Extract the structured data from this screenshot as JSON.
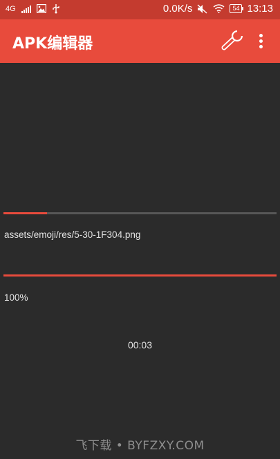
{
  "status_bar": {
    "network": "4G",
    "speed": "0.0K/s",
    "battery": "54",
    "time": "13:13"
  },
  "app_bar": {
    "title": "APK编辑器",
    "icons": [
      "wrench-icon",
      "more-vert-icon"
    ]
  },
  "task": {
    "file_progress_value": 0.16,
    "current_file": "assets/emoji/res/5-30-1F304.png",
    "overall_progress_value": 1.0,
    "percent_label": "100%",
    "elapsed": "00:03"
  },
  "watermark": "飞下载 • BYFZXY.COM",
  "colors": {
    "status_bar": "#c43b2f",
    "app_bar": "#e84b3c",
    "background": "#2b2b2b",
    "progress_fill": "#e84b3c",
    "progress_track": "#575757"
  }
}
